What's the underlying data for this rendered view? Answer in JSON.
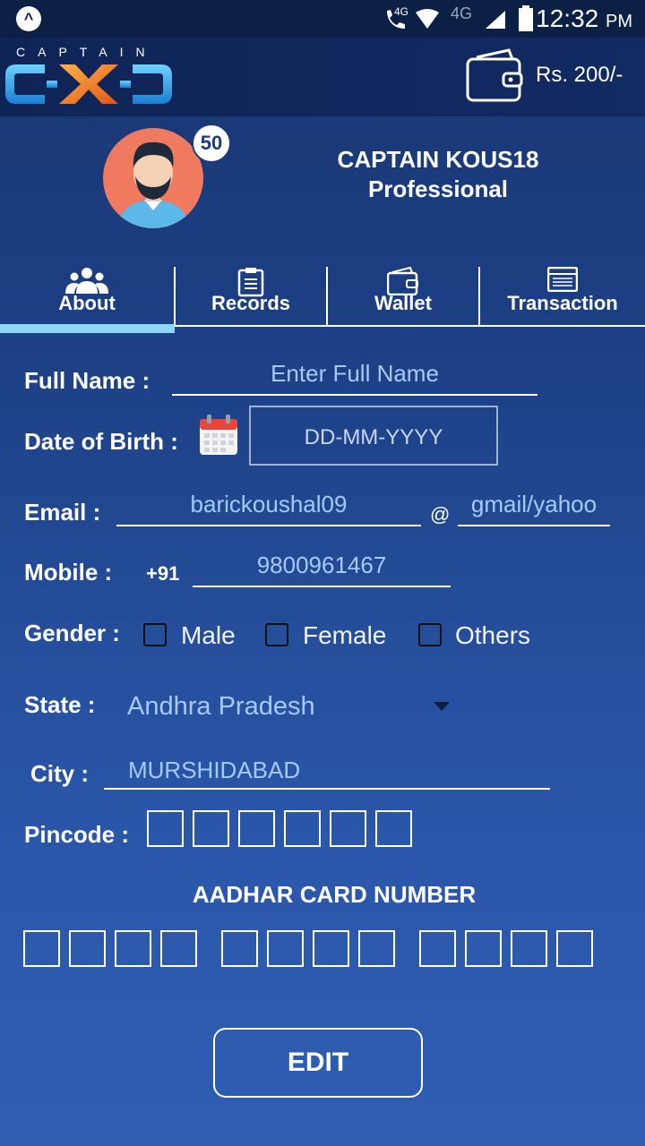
{
  "status_bar": {
    "time": "12:32",
    "ampm": "PM",
    "network_labels": [
      "4G",
      "4G"
    ]
  },
  "header": {
    "brand_word": "CAPTAIN",
    "wallet_amount": "Rs. 200/-"
  },
  "profile": {
    "badge_count": "50",
    "name": "CAPTAIN KOUS18",
    "level": "Professional"
  },
  "tabs": [
    {
      "label": "About",
      "icon": "group-icon",
      "active": true
    },
    {
      "label": "Records",
      "icon": "clipboard-icon",
      "active": false
    },
    {
      "label": "Wallet",
      "icon": "wallet-icon",
      "active": false
    },
    {
      "label": "Transaction",
      "icon": "receipt-icon",
      "active": false
    }
  ],
  "form": {
    "full_name_label": "Full Name :",
    "full_name_placeholder": "Enter Full Name",
    "dob_label": "Date of Birth :",
    "dob_placeholder": "DD-MM-YYYY",
    "email_label": "Email :",
    "email_user": "barickoushal09",
    "email_at": "@",
    "email_domain": "gmail/yahoo",
    "mobile_label": "Mobile :",
    "mobile_prefix": "+91",
    "mobile_value": "9800961467",
    "gender_label": "Gender :",
    "gender_options": [
      "Male",
      "Female",
      "Others"
    ],
    "state_label": "State :",
    "state_value": "Andhra Pradesh",
    "city_label": "City :",
    "city_value": "MURSHIDABAD",
    "pincode_label": "Pincode :",
    "aadhar_title": "AADHAR CARD NUMBER"
  },
  "edit_button": "EDIT",
  "colors": {
    "background_top": "#173570",
    "background_bottom": "#2f5eb2",
    "header": "#0f2456",
    "accent_tab": "#8ed6f5",
    "field_text": "#a8c9ff",
    "brand_orange": "#f07a1a",
    "brand_blue": "#2fa8e8"
  }
}
